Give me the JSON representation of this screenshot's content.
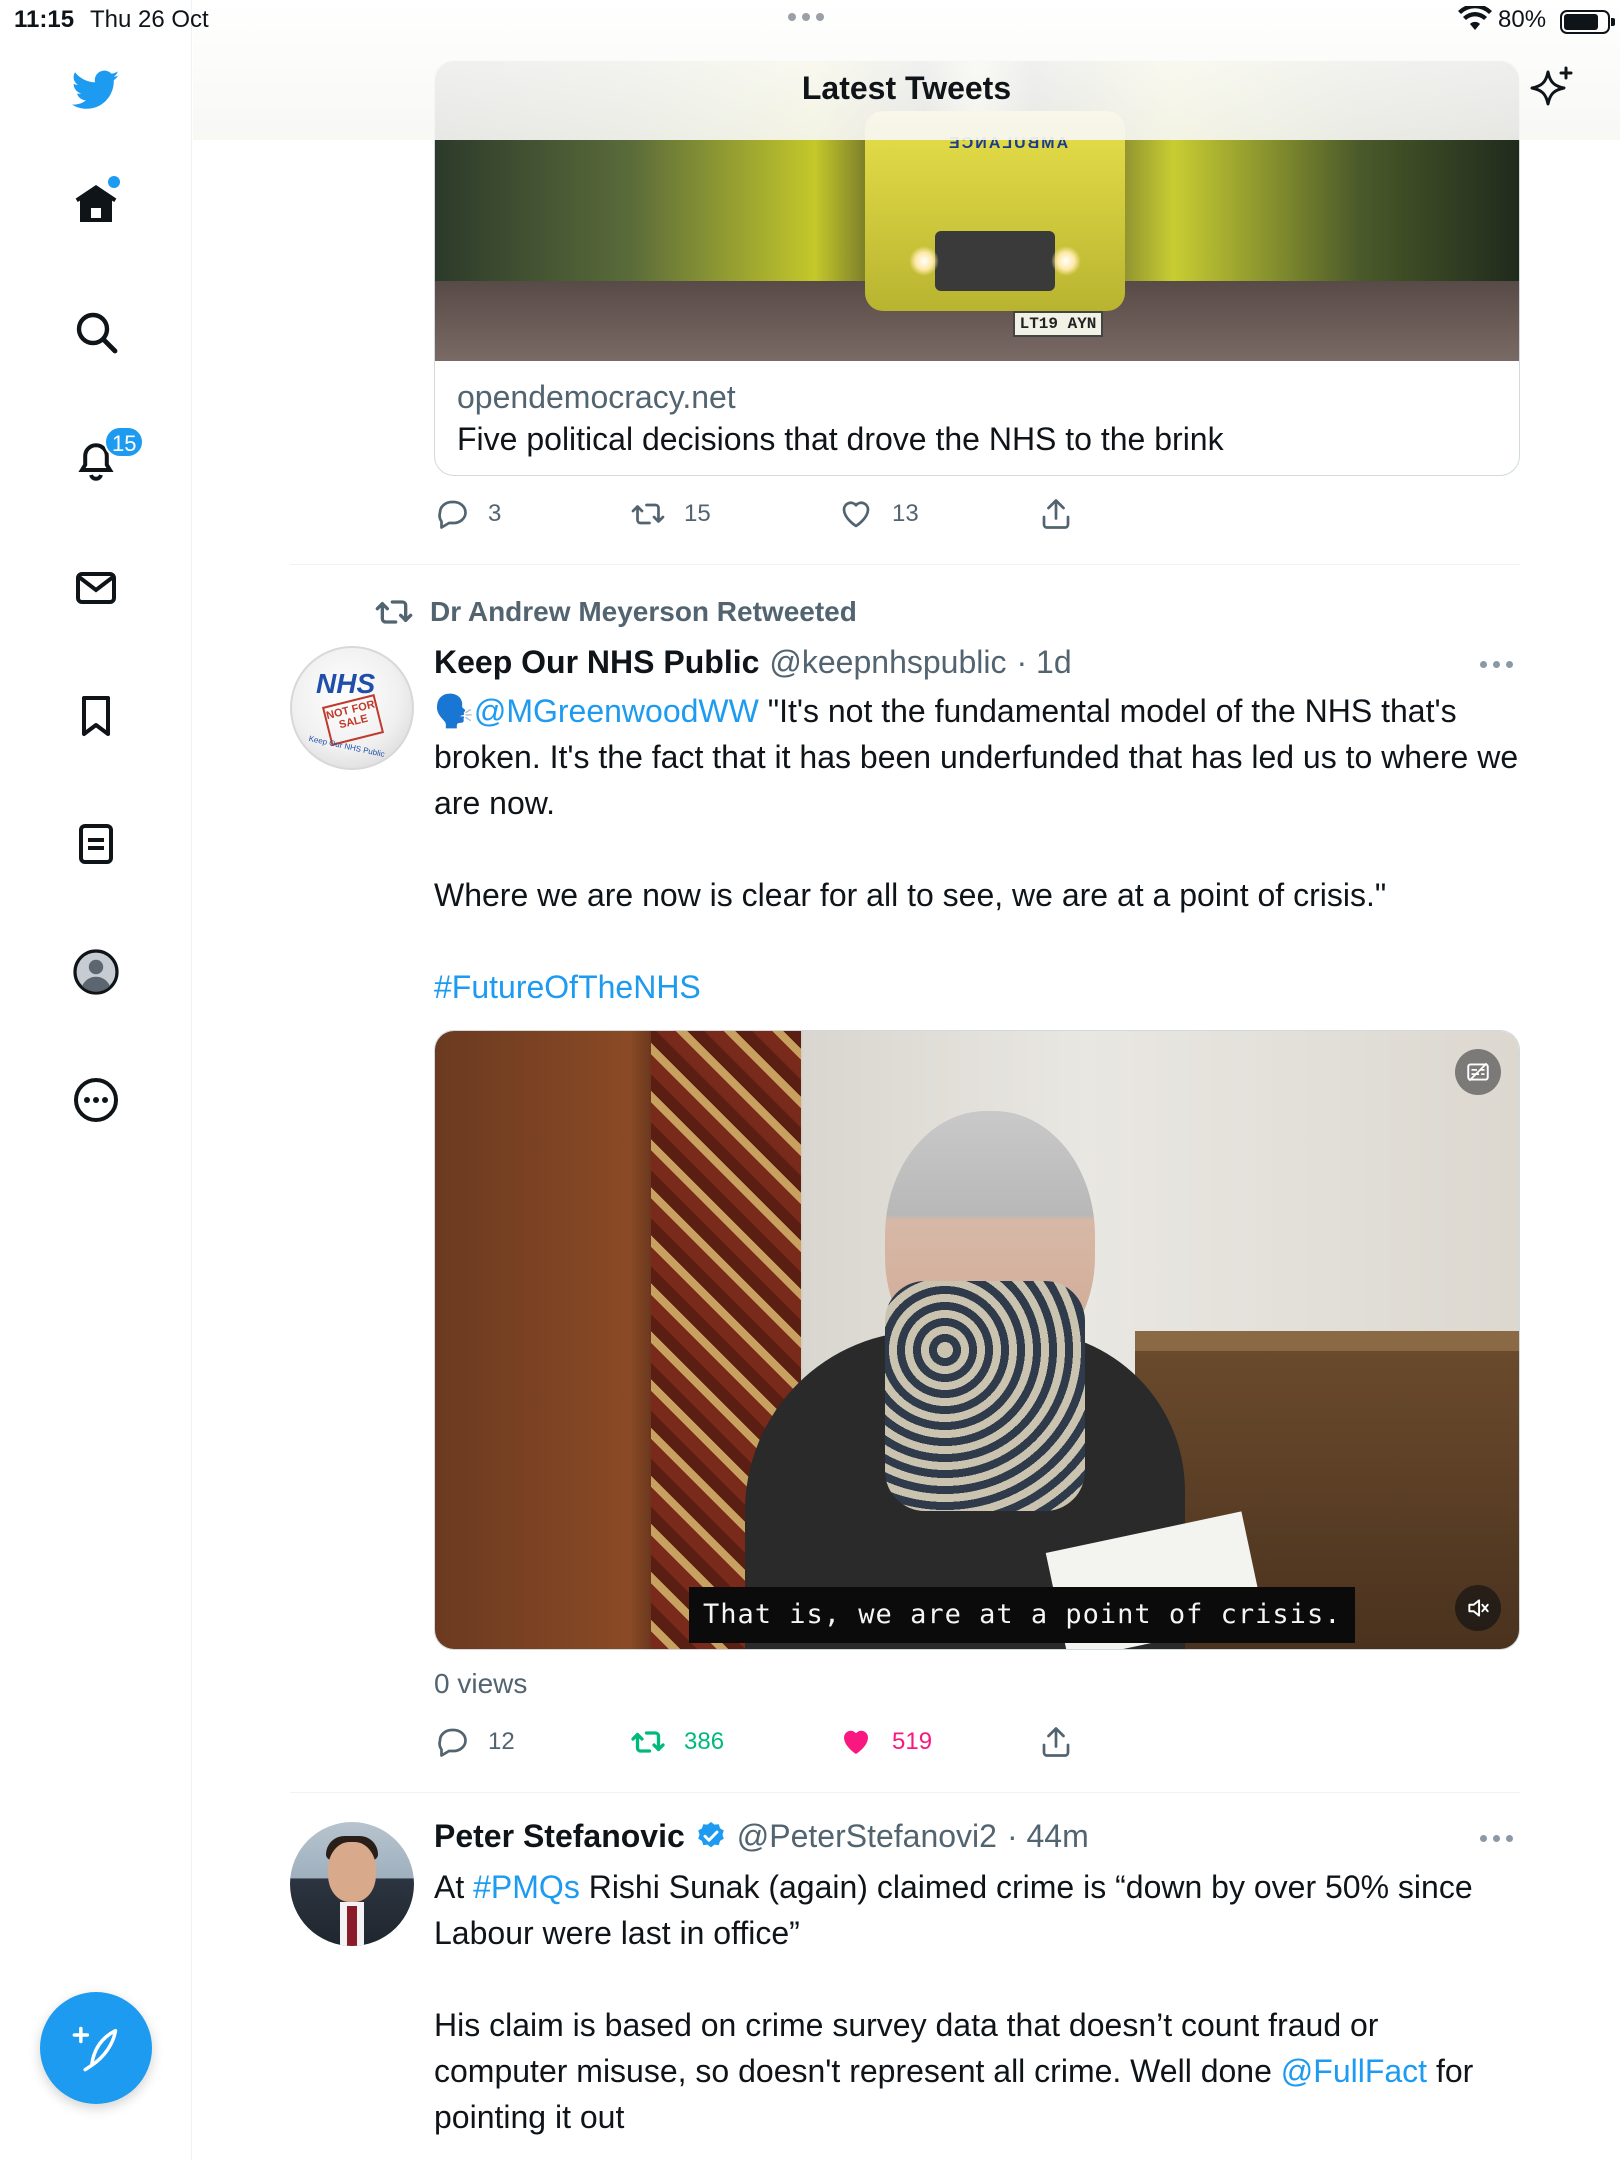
{
  "status_bar": {
    "time": "11:15",
    "date": "Thu 26 Oct",
    "battery_percent": "80%",
    "battery_level": 0.8,
    "wifi_icon": "wifi-icon"
  },
  "header": {
    "title": "Latest Tweets",
    "sparkle_icon": "sparkle-icon"
  },
  "sidebar": {
    "items": [
      {
        "name": "twitter-logo-icon"
      },
      {
        "name": "home-icon",
        "has_dot": true
      },
      {
        "name": "search-icon"
      },
      {
        "name": "notifications-icon",
        "badge": "15"
      },
      {
        "name": "messages-icon"
      },
      {
        "name": "bookmarks-icon"
      },
      {
        "name": "lists-icon"
      },
      {
        "name": "profile-icon"
      },
      {
        "name": "more-icon"
      }
    ],
    "compose_icon": "compose-icon"
  },
  "tweet1": {
    "card": {
      "domain": "opendemocracy.net",
      "headline": "Five political decisions that drove the NHS to the brink",
      "image_texts": {
        "vehicle_marking": "AMBULANCE",
        "license_plate": "LT19 AYN"
      }
    },
    "actions": {
      "replies": "3",
      "retweets": "15",
      "likes": "13"
    }
  },
  "tweet2": {
    "retweeted_by": "Dr Andrew Meyerson Retweeted",
    "avatar_text": {
      "logo": "NHS",
      "stamp": "NOT FOR SALE",
      "ring": "Keep Our NHS Public"
    },
    "author_name": "Keep Our NHS Public",
    "handle": "@keepnhspublic",
    "time": "· 1d",
    "emoji": "🗣️",
    "mention": "@MGreenwoodWW",
    "text_line1": "  \"It's not the fundamental model of the NHS that's broken. It's the fact that it has been underfunded that has led us to where we are now.",
    "text_para2": "Where we are now is clear for all to see, we are at a point of crisis.\"",
    "hashtag": "#FutureOfTheNHS",
    "video_caption": "That is, we are at a point of crisis.",
    "views": "0 views",
    "actions": {
      "replies": "12",
      "retweets": "386",
      "likes": "519",
      "retweet_color": "#00ba7c",
      "like_color": "#f91880"
    }
  },
  "tweet3": {
    "author_name": "Peter Stefanovic",
    "handle": "@PeterStefanovi2",
    "time": "· 44m",
    "text_pre": "At ",
    "hashtag": "#PMQs",
    "text_after_hashtag": " Rishi Sunak (again) claimed crime is “down by over 50% since Labour were last in office”",
    "text_para2_pre": "His claim is based on crime survey data that doesn’t count fraud or computer misuse, so doesn't represent all crime. Well done ",
    "mention": "@FullFact",
    "text_para2_post": " for pointing it out"
  },
  "colors": {
    "accent": "#1d9bf0",
    "text_primary": "#0f1419",
    "text_secondary": "#536471"
  }
}
